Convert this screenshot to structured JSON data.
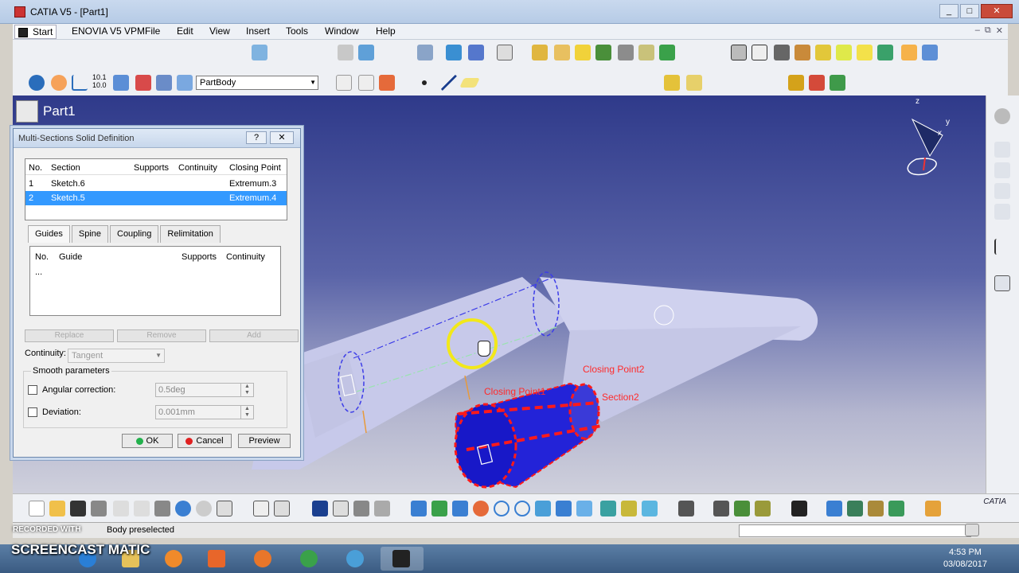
{
  "window": {
    "title": "CATIA V5 - [Part1]",
    "buttons": {
      "minimize": "_",
      "maximize": "□",
      "close": "✕"
    }
  },
  "menu": {
    "items": [
      "Start",
      "ENOVIA V5 VPM",
      "File",
      "Edit",
      "View",
      "Insert",
      "Tools",
      "Window",
      "Help"
    ],
    "doc_controls": {
      "minimize": "–",
      "restore": "⧉",
      "close": "✕"
    }
  },
  "toolbar": {
    "body_select": "PartBody",
    "stamp_10_1": "10.1",
    "stamp_10_0": "10.0"
  },
  "viewport": {
    "tree_root": "Part1",
    "annotations": {
      "closing_point2": "Closing Point2",
      "closing_point1": "Closing Point1",
      "section2": "Section2"
    },
    "compass_axes": {
      "z": "z",
      "y": "y",
      "x": "x"
    }
  },
  "dialog": {
    "title": "Multi-Sections Solid Definition",
    "help": "?",
    "close": "✕",
    "section_table": {
      "headers": [
        "No.",
        "Section",
        "Supports",
        "Continuity",
        "Closing Point"
      ],
      "rows": [
        {
          "no": "1",
          "section": "Sketch.6",
          "closing": "Extremum.3"
        },
        {
          "no": "2",
          "section": "Sketch.5",
          "closing": "Extremum.4"
        }
      ]
    },
    "tabs": [
      "Guides",
      "Spine",
      "Coupling",
      "Relimitation"
    ],
    "guide_table": {
      "headers": [
        "No.",
        "Guide",
        "Supports",
        "Continuity"
      ],
      "placeholder_row": "..."
    },
    "buttons": {
      "replace": "Replace",
      "remove": "Remove",
      "add": "Add"
    },
    "continuity_label": "Continuity:",
    "continuity_value": "Tangent",
    "smooth_legend": "Smooth parameters",
    "angular_label": "Angular correction:",
    "angular_value": "0.5deg",
    "deviation_label": "Deviation:",
    "deviation_value": "0.001mm",
    "ok": "OK",
    "cancel": "Cancel",
    "preview": "Preview"
  },
  "status": {
    "text": "Body preselected",
    "recorded_with": "RECORDED WITH",
    "screencast": "SCREENCAST",
    "matic": "MATIC"
  },
  "catia_logo": "CATIA",
  "taskbar": {
    "time": "4:53 PM",
    "date": "03/08/2017"
  },
  "colors": {
    "viewport_top": "#2f3a8a",
    "selection": "#3399ff",
    "pipe": "#c9cbec",
    "loft_red": "#ff1a1a",
    "loft_blue": "#1f1fd6",
    "highlight_ring": "#f2e81a"
  }
}
